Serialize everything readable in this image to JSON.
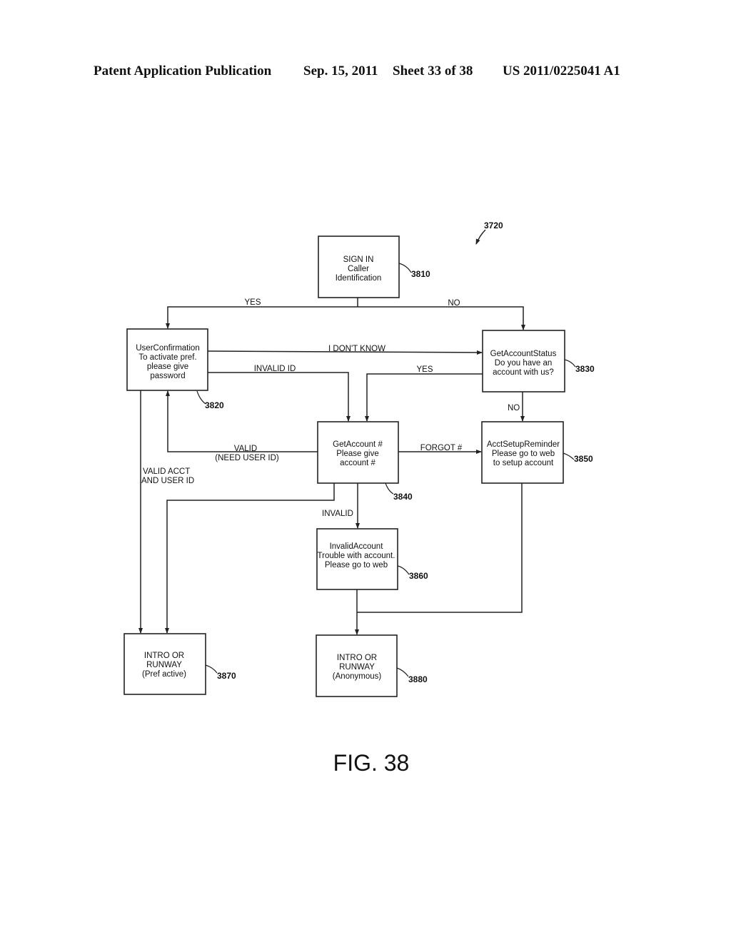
{
  "header": {
    "publication": "Patent Application Publication",
    "date": "Sep. 15, 2011",
    "sheet": "Sheet 33 of 38",
    "number": "US 2011/0225041 A1"
  },
  "diagram": {
    "ref": "3720",
    "nodes": {
      "sign_in": {
        "lines": [
          "SIGN IN",
          "Caller",
          "Identification"
        ],
        "ref": "3810"
      },
      "user_confirmation": {
        "lines": [
          "UserConfirmation",
          "To activate pref.",
          "please give",
          "password"
        ],
        "ref": "3820"
      },
      "get_account_status": {
        "lines": [
          "GetAccountStatus",
          "Do you have an",
          "account with us?"
        ],
        "ref": "3830"
      },
      "get_account": {
        "lines": [
          "GetAccount #",
          "Please give",
          "account #"
        ],
        "ref": "3840"
      },
      "acct_setup_reminder": {
        "lines": [
          "AcctSetupReminder",
          "Please go to web",
          "to setup account"
        ],
        "ref": "3850"
      },
      "invalid_account": {
        "lines": [
          "InvalidAccount",
          "Trouble with account.",
          "Please go to web"
        ],
        "ref": "3860"
      },
      "intro_pref": {
        "lines": [
          "INTRO OR",
          "RUNWAY",
          "(Pref active)"
        ],
        "ref": "3870"
      },
      "intro_anon": {
        "lines": [
          "INTRO OR",
          "RUNWAY",
          "(Anonymous)"
        ],
        "ref": "3880"
      }
    },
    "edges": {
      "yes": "YES",
      "no": "NO",
      "i_dont_know": "I DON'T KNOW",
      "invalid_id": "INVALID ID",
      "status_yes": "YES",
      "status_no": "NO",
      "valid_need": [
        "VALID",
        "(NEED USER ID)"
      ],
      "forgot": "FORGOT #",
      "valid_acct": [
        "VALID ACCT",
        "AND USER ID"
      ],
      "invalid": "INVALID"
    }
  },
  "figure_label": "FIG. 38"
}
